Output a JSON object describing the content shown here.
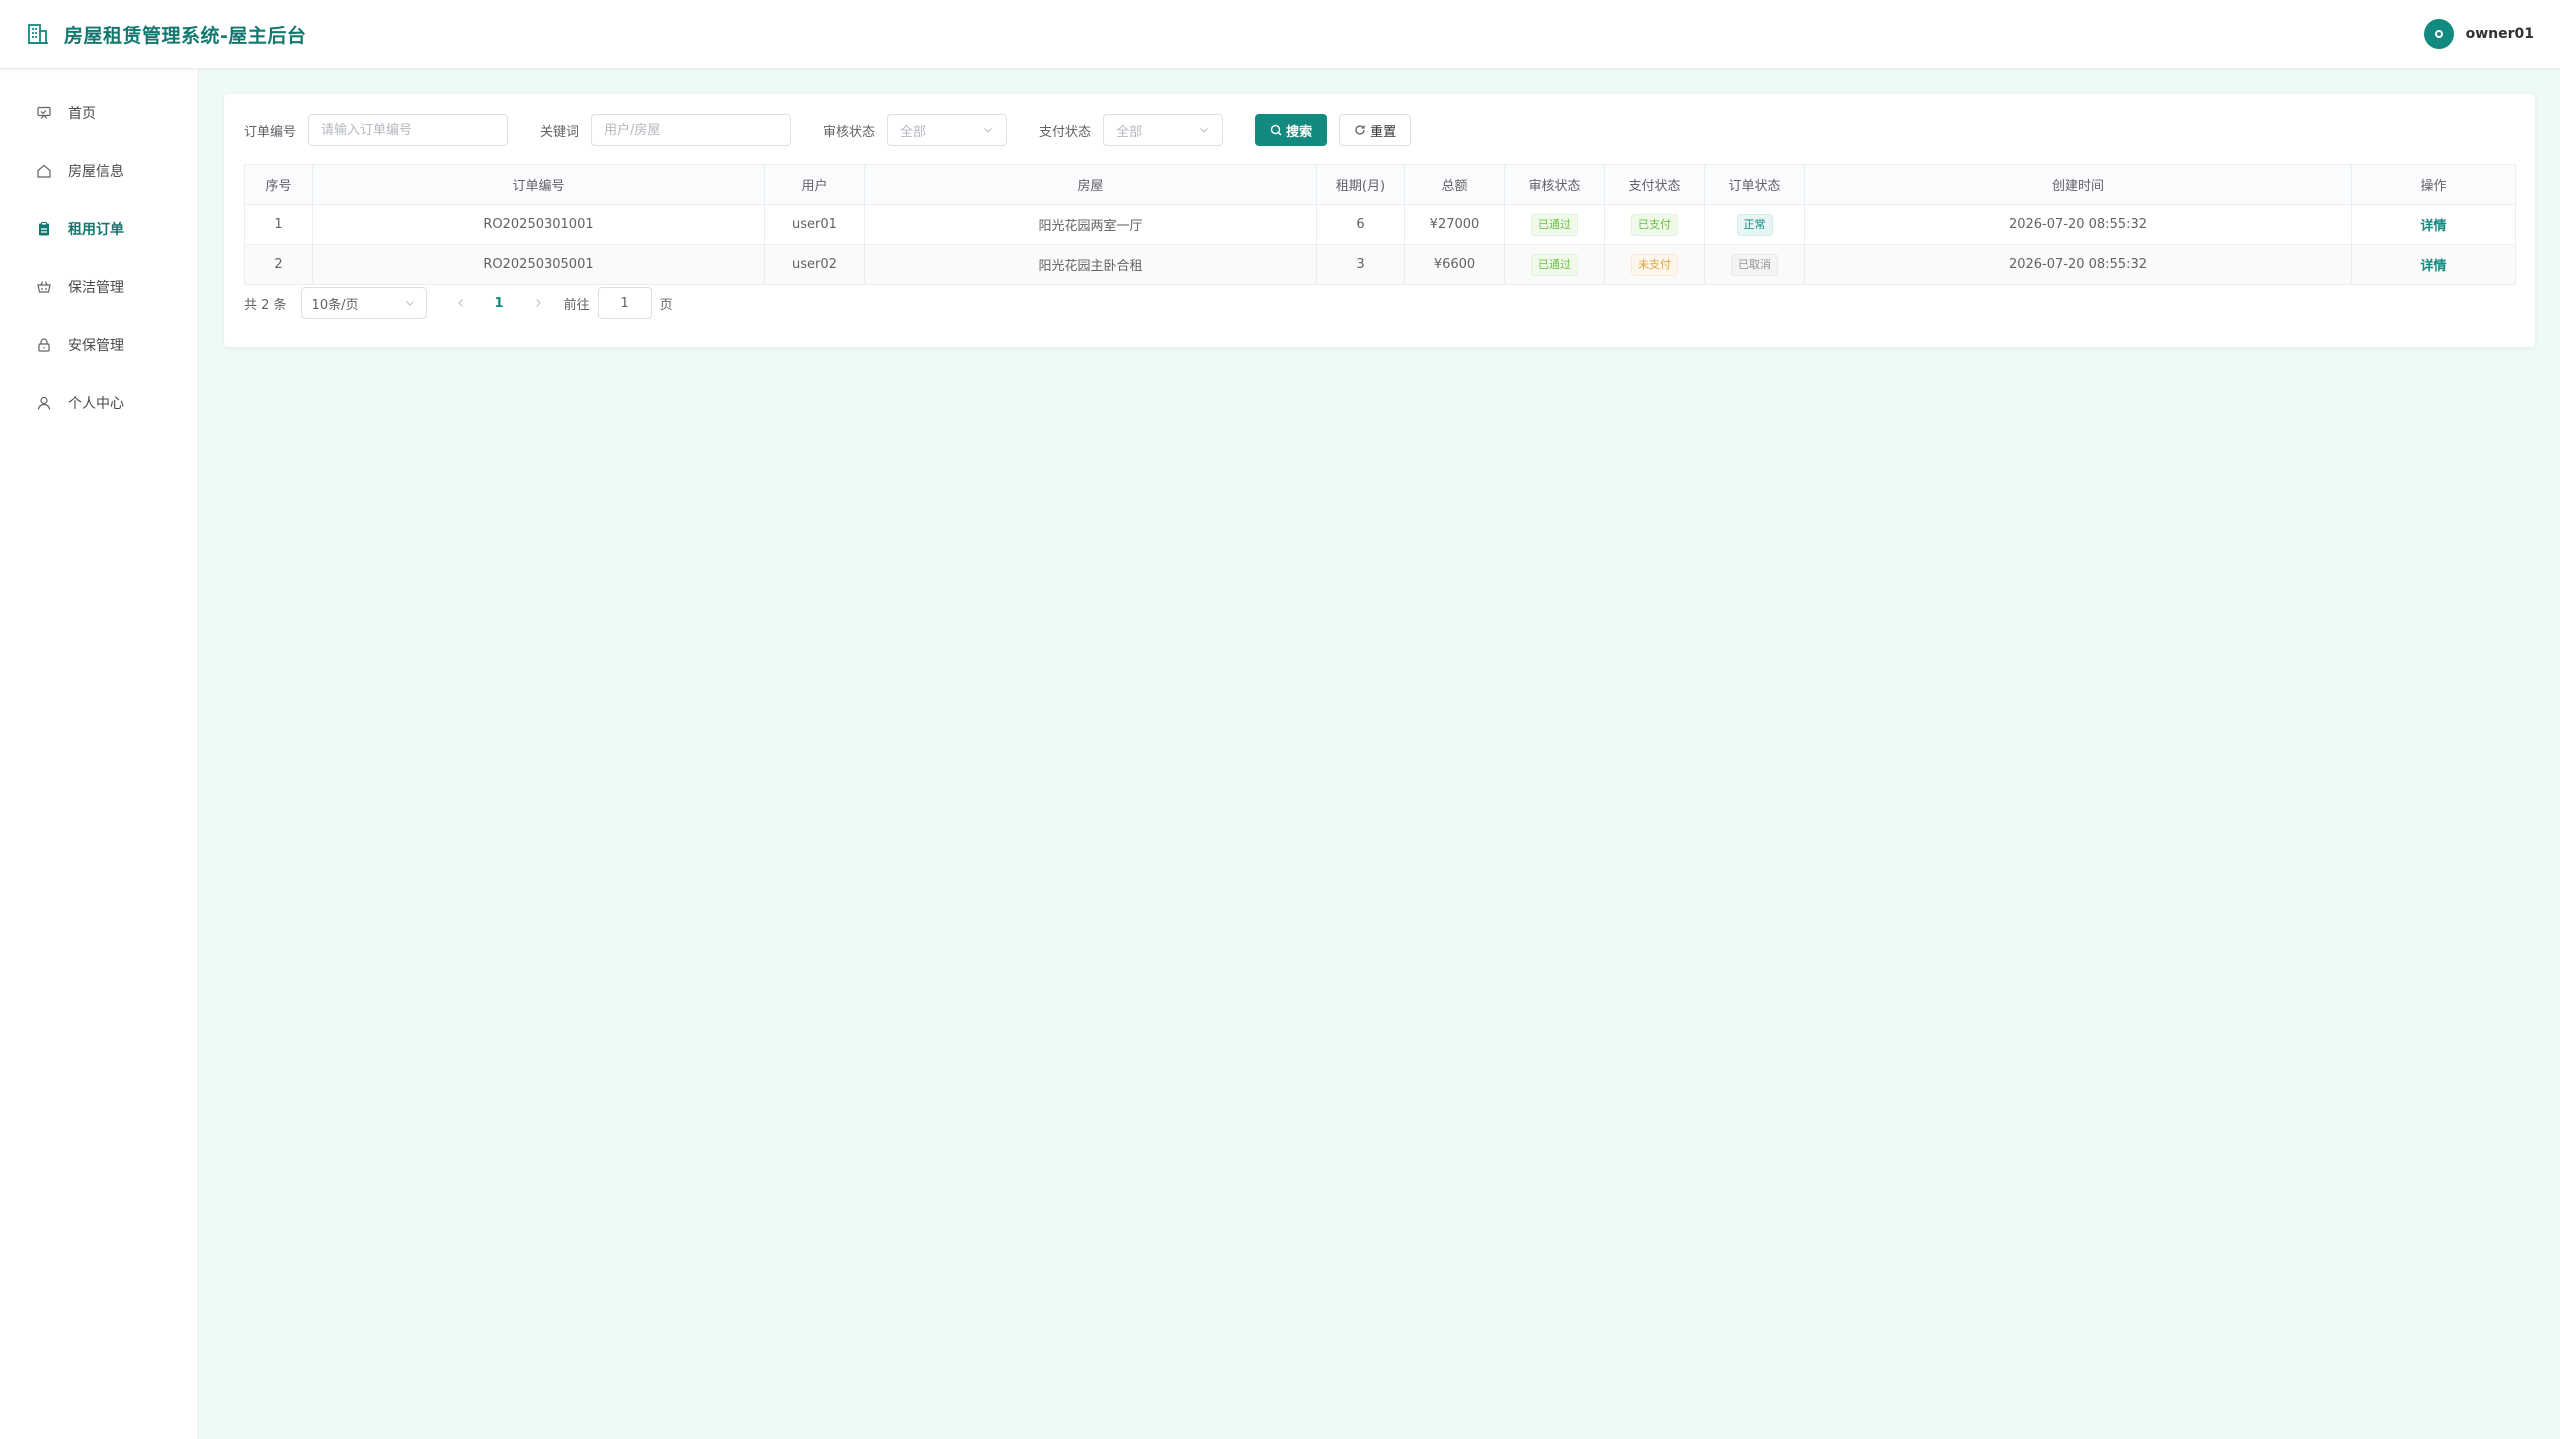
{
  "header": {
    "title": "房屋租赁管理系统-屋主后台",
    "username": "owner01"
  },
  "sidebar": {
    "items": [
      {
        "label": "首页",
        "icon": "home-board-icon"
      },
      {
        "label": "房屋信息",
        "icon": "house-icon"
      },
      {
        "label": "租用订单",
        "icon": "clipboard-icon",
        "active": true
      },
      {
        "label": "保洁管理",
        "icon": "basket-icon"
      },
      {
        "label": "安保管理",
        "icon": "lock-icon"
      },
      {
        "label": "个人中心",
        "icon": "user-icon"
      }
    ]
  },
  "filters": {
    "order_no_label": "订单编号",
    "order_no_placeholder": "请输入订单编号",
    "keyword_label": "关键词",
    "keyword_placeholder": "用户/房屋",
    "audit_label": "审核状态",
    "audit_value": "全部",
    "pay_label": "支付状态",
    "pay_value": "全部",
    "search_button": "搜索",
    "reset_button": "重置"
  },
  "table": {
    "columns": [
      "序号",
      "订单编号",
      "用户",
      "房屋",
      "租期(月)",
      "总额",
      "审核状态",
      "支付状态",
      "订单状态",
      "创建时间",
      "操作"
    ],
    "rows": [
      {
        "index": "1",
        "order_no": "RO20250301001",
        "user": "user01",
        "house": "阳光花园两室一厅",
        "term": "6",
        "total": "¥27000",
        "audit": "已通过",
        "pay": "已支付",
        "status": "正常",
        "created": "2026-07-20 08:55:32",
        "action": "详情"
      },
      {
        "index": "2",
        "order_no": "RO20250305001",
        "user": "user02",
        "house": "阳光花园主卧合租",
        "term": "3",
        "total": "¥6600",
        "audit": "已通过",
        "pay": "未支付",
        "status": "已取消",
        "created": "2026-07-20 08:55:32",
        "action": "详情"
      }
    ]
  },
  "pagination": {
    "total": "共 2 条",
    "page_size": "10条/页",
    "current_page": "1",
    "goto_label": "前往",
    "goto_value": "1",
    "page_suffix": "页"
  },
  "colors": {
    "primary": "#128a7f",
    "background": "#eefaf8",
    "success": "#67c23a",
    "warning": "#e6a23c",
    "info": "#909399"
  }
}
